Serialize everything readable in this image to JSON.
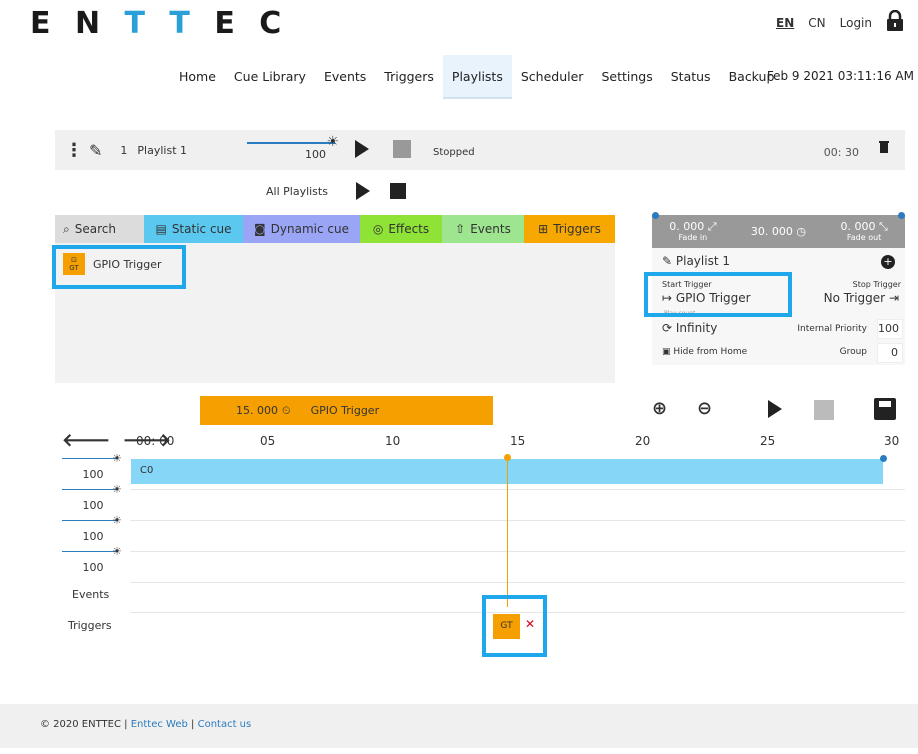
{
  "brand": {
    "logo": "ENTTEC"
  },
  "top_links": {
    "en": "EN",
    "cn": "CN",
    "login": "Login",
    "lock_icon": "lock-icon"
  },
  "nav": {
    "items": [
      "Home",
      "Cue Library",
      "Events",
      "Triggers",
      "Playlists",
      "Scheduler",
      "Settings",
      "Status",
      "Backup"
    ],
    "active": "Playlists",
    "datetime": "Feb 9 2021 03:11:16 AM"
  },
  "playlist_bar": {
    "number": "1",
    "name": "Playlist 1",
    "level": "100",
    "status": "Stopped",
    "duration": "00: 30"
  },
  "all_playlists": {
    "label": "All Playlists"
  },
  "library": {
    "tabs": {
      "search": "Search",
      "static": "Static cue",
      "dynamic": "Dynamic cue",
      "effects": "Effects",
      "events": "Events",
      "triggers": "Triggers"
    },
    "item": {
      "badge": "GT",
      "label": "GPIO Trigger"
    }
  },
  "props": {
    "fade_in": "0. 000",
    "fade_in_label": "Fade in",
    "duration": "30. 000",
    "fade_out": "0. 000",
    "fade_out_label": "Fade out",
    "playlist_name": "Playlist 1",
    "start_trigger_label": "Start Trigger",
    "start_trigger_value": "GPIO Trigger",
    "stop_trigger_label": "Stop Trigger",
    "stop_trigger_value": "No Trigger",
    "play_count_label": "Play count",
    "play_count_value": "Infinity",
    "internal_priority_label": "Internal Priority",
    "internal_priority_value": "100",
    "hide_from_home_label": "Hide from Home",
    "group_label": "Group",
    "group_value": "0"
  },
  "timeline": {
    "header_time": "15. 000",
    "header_label": "GPIO Trigger",
    "time_start": "00: 00",
    "ticks": [
      "05",
      "10",
      "15",
      "20",
      "25",
      "30"
    ],
    "lanes": [
      "100",
      "100",
      "100",
      "100"
    ],
    "cue_label": "C0",
    "events_label": "Events",
    "triggers_label": "Triggers",
    "trigger_badge": "GT"
  },
  "footer": {
    "copyright": "© 2020 ENTTEC",
    "sep": "|",
    "link1": "Enttec Web",
    "link2": "Contact us"
  }
}
